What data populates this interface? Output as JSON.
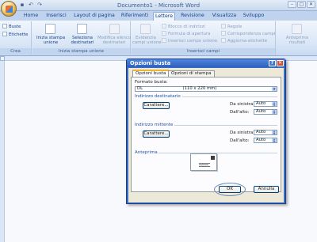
{
  "window": {
    "title": "Documento1 - Microsoft Word",
    "controls": [
      "–",
      "□",
      "✕"
    ]
  },
  "quick_access": [
    "save-icon",
    "undo-icon",
    "redo-icon"
  ],
  "ribbon_tabs": [
    "Home",
    "Inserisci",
    "Layout di pagina",
    "Riferimenti",
    "Lettere",
    "Revisione",
    "Visualizza",
    "Sviluppo"
  ],
  "active_tab": "Lettere",
  "ribbon": {
    "crea": {
      "label": "Crea",
      "buste": "Buste",
      "etichette": "Etichette"
    },
    "inizia": {
      "label": "Inizia stampa unione",
      "inizia_1": "Inizia stampa",
      "inizia_2": "unione",
      "seleziona_1": "Seleziona",
      "seleziona_2": "destinatari",
      "modifica_1": "Modifica elenco",
      "modifica_2": "destinatari"
    },
    "inserisci": {
      "label": "Inserisci campi",
      "evidenzia_1": "Evidenzia",
      "evidenzia_2": "campi unione",
      "blocco": "Blocco di indirizzi",
      "formula": "Formula di apertura",
      "inserisci_campo": "Inserisci campo unione",
      "regole": "Regole",
      "corrispondenza": "Corrispondenza campi",
      "aggiorna": "Aggiorna etichette"
    },
    "anteprima": {
      "line1": "Anteprima",
      "line2": "risultati"
    }
  },
  "dialog": {
    "title": "Opzioni busta",
    "help": "?",
    "close": "✕",
    "tabs": [
      "Opzioni busta",
      "Opzioni di stampa"
    ],
    "formato_label": "Formato busta:",
    "formato_value": "DL                              (110 x 220 mm)",
    "destinatario": {
      "section": "Indirizzo destinatario",
      "font_button": "Carattere...",
      "left_label": "Da sinistra:",
      "left_value": "Auto",
      "top_label": "Dall'alto:",
      "top_value": "Auto"
    },
    "mittente": {
      "section": "Indirizzo mittente",
      "font_button": "Carattere...",
      "left_label": "Da sinistra:",
      "left_value": "Auto",
      "top_label": "Dall'alto:",
      "top_value": "Auto"
    },
    "preview_label": "Anteprima",
    "ok": "OK",
    "cancel": "Annulla"
  }
}
